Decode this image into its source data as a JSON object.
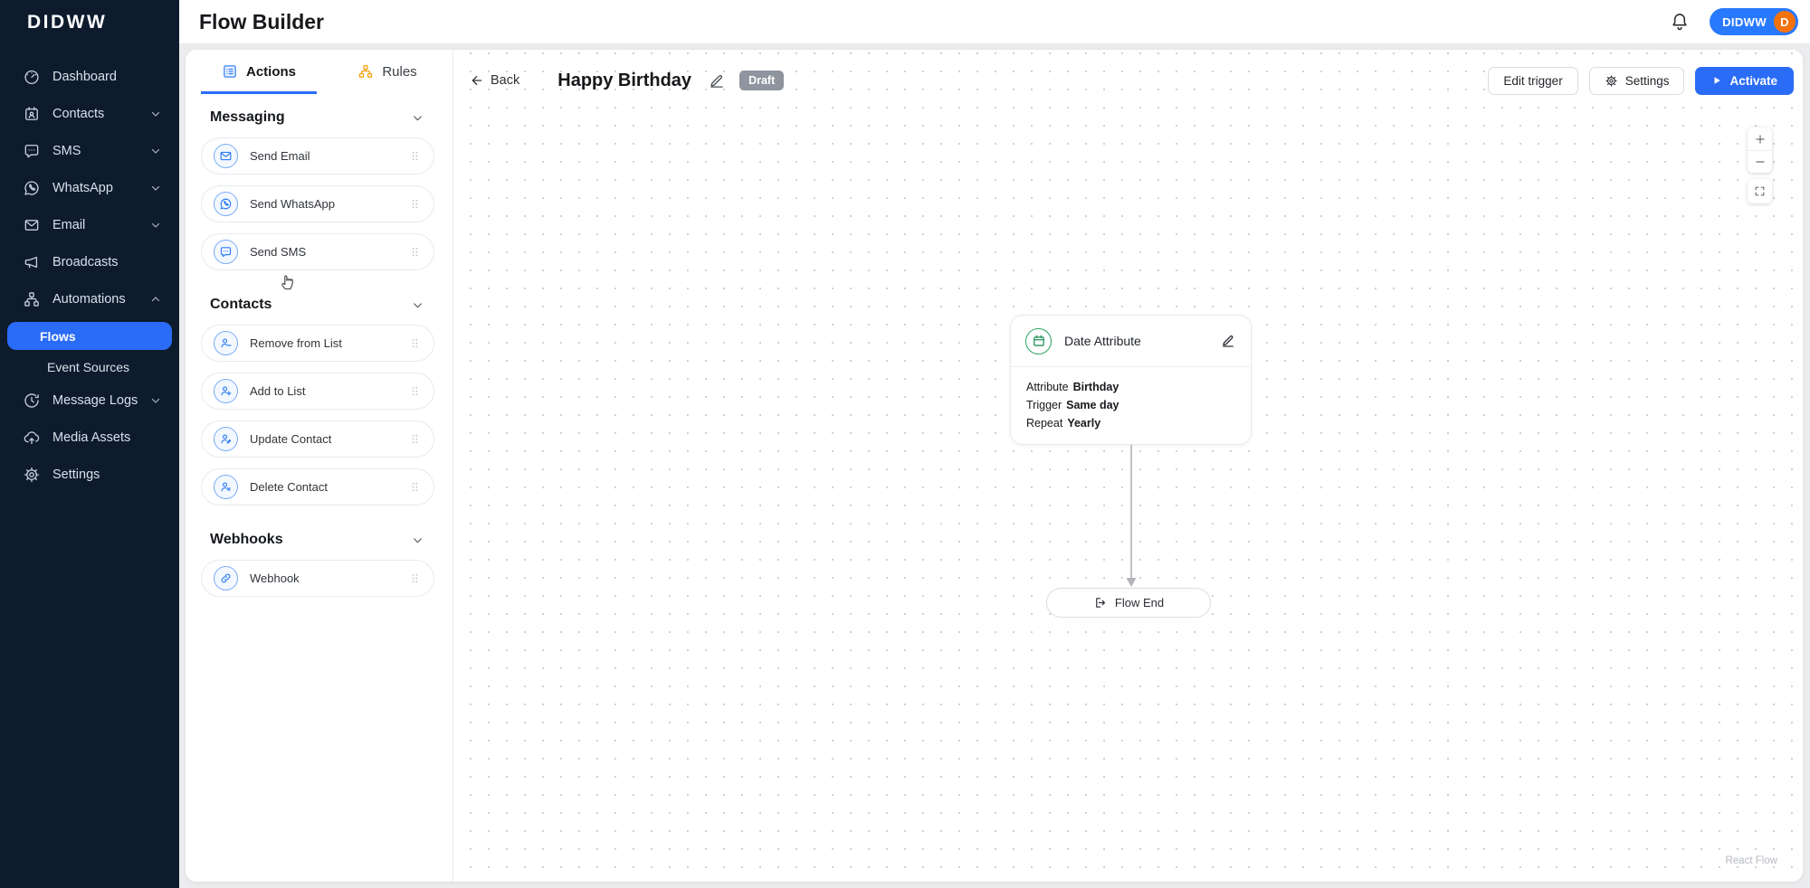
{
  "brand": {
    "logo": "DIDWW"
  },
  "header": {
    "title": "Flow Builder",
    "account_label": "DIDWW",
    "avatar_initial": "D"
  },
  "sidebar": {
    "items": [
      {
        "label": "Dashboard"
      },
      {
        "label": "Contacts"
      },
      {
        "label": "SMS"
      },
      {
        "label": "WhatsApp"
      },
      {
        "label": "Email"
      },
      {
        "label": "Broadcasts"
      },
      {
        "label": "Automations"
      },
      {
        "label": "Message Logs"
      },
      {
        "label": "Media Assets"
      },
      {
        "label": "Settings"
      }
    ],
    "automations_children": [
      {
        "label": "Flows",
        "active": true
      },
      {
        "label": "Event Sources",
        "active": false
      }
    ]
  },
  "panel": {
    "tabs": [
      {
        "label": "Actions",
        "active": true
      },
      {
        "label": "Rules",
        "active": false
      }
    ],
    "sections": [
      {
        "title": "Messaging",
        "items": [
          {
            "label": "Send Email"
          },
          {
            "label": "Send WhatsApp"
          },
          {
            "label": "Send SMS"
          }
        ]
      },
      {
        "title": "Contacts",
        "items": [
          {
            "label": "Remove from List"
          },
          {
            "label": "Add to List"
          },
          {
            "label": "Update Contact"
          },
          {
            "label": "Delete Contact"
          }
        ]
      },
      {
        "title": "Webhooks",
        "items": [
          {
            "label": "Webhook"
          }
        ]
      }
    ]
  },
  "canvas": {
    "back_label": "Back",
    "flow_title": "Happy Birthday",
    "status_badge": "Draft",
    "edit_trigger_label": "Edit trigger",
    "settings_label": "Settings",
    "activate_label": "Activate",
    "node": {
      "title": "Date Attribute",
      "fields": [
        {
          "label": "Attribute",
          "value": "Birthday"
        },
        {
          "label": "Trigger",
          "value": "Same day"
        },
        {
          "label": "Repeat",
          "value": "Yearly"
        }
      ]
    },
    "end_node_label": "Flow End",
    "watermark": "React Flow"
  },
  "colors": {
    "sidebar_bg": "#0d1b2d",
    "accent_blue": "#2b6cf6",
    "account_blue": "#2979ff",
    "avatar_orange": "#f2720c",
    "draft_badge_gray": "#8e959e",
    "node_green": "#2aa262",
    "action_icon_blue": "#2f7df6",
    "rules_tab_orange": "#f59e0b",
    "edge_gray": "#b1b3b9"
  }
}
